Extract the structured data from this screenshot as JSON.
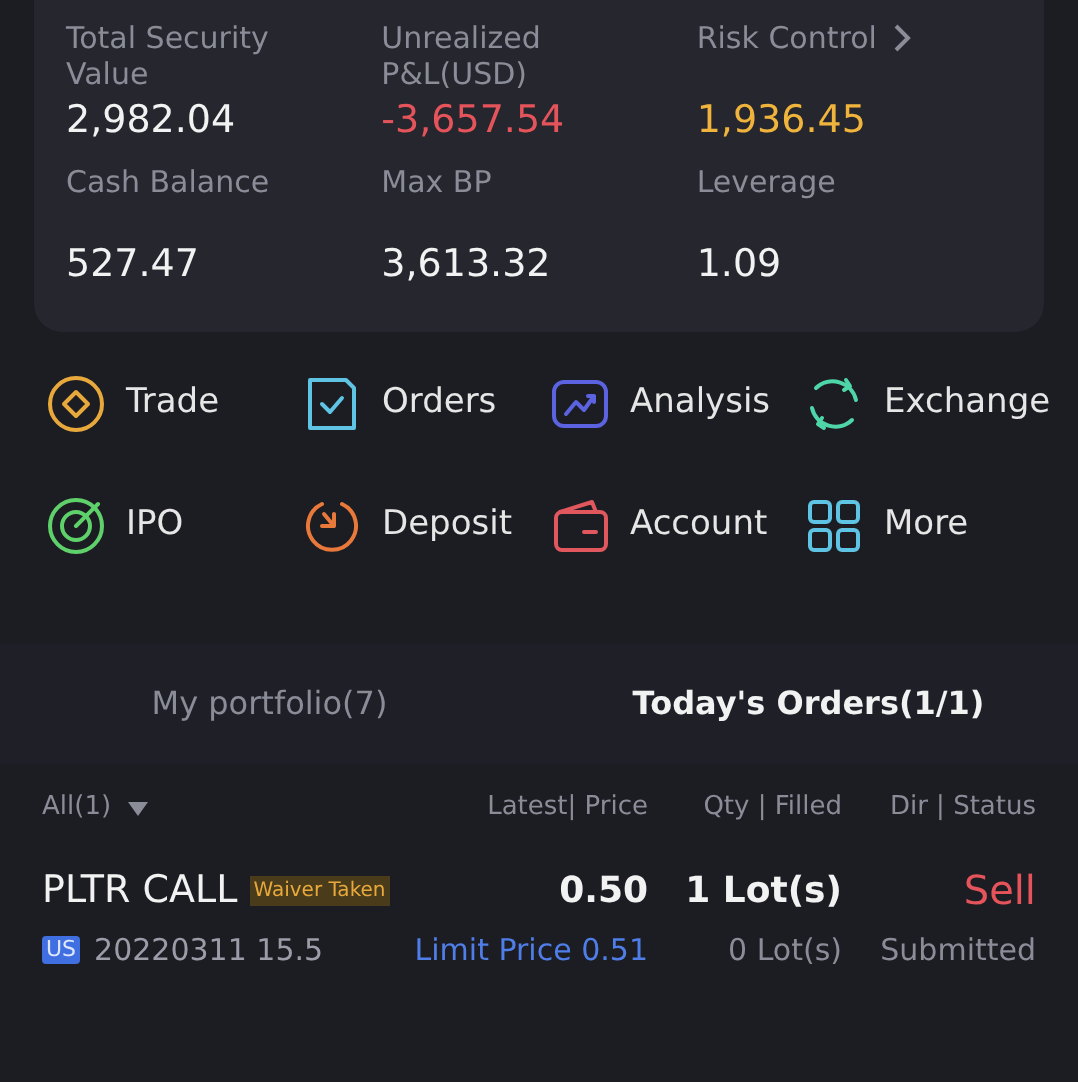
{
  "summary": {
    "metrics": [
      {
        "label": "Total Security Value",
        "value": "2,982.04",
        "color": "#f2f2f2",
        "link": false
      },
      {
        "label": "Unrealized P&L(USD)",
        "value": "-3,657.54",
        "color": "#e5545a",
        "link": false
      },
      {
        "label": "Risk Control",
        "value": "1,936.45",
        "color": "#f0b43c",
        "link": true
      },
      {
        "label": "Cash Balance",
        "value": "527.47",
        "color": "#f2f2f2",
        "link": false
      },
      {
        "label": "Max BP",
        "value": "3,613.32",
        "color": "#f2f2f2",
        "link": false
      },
      {
        "label": "Leverage",
        "value": "1.09",
        "color": "#f2f2f2",
        "link": false
      }
    ]
  },
  "actions": [
    {
      "label": "Trade",
      "kind": "trade",
      "color": "#e8a93c"
    },
    {
      "label": "Orders",
      "kind": "orders",
      "color": "#5fc3e4"
    },
    {
      "label": "Analysis",
      "kind": "analysis",
      "color": "#5b63e0"
    },
    {
      "label": "Exchange",
      "kind": "exchange",
      "color": "#4fd6a8"
    },
    {
      "label": "IPO",
      "kind": "ipo",
      "color": "#5fd16a"
    },
    {
      "label": "Deposit",
      "kind": "deposit",
      "color": "#e8793a"
    },
    {
      "label": "Account",
      "kind": "account",
      "color": "#e0585e"
    },
    {
      "label": "More",
      "kind": "more",
      "color": "#5fc3e4"
    }
  ],
  "tabs": [
    {
      "label": "My portfolio(7)",
      "selected": false
    },
    {
      "label": "Today's Orders(1/1)",
      "selected": true
    }
  ],
  "orders": {
    "filter": "All(1)",
    "columns": [
      "Latest| Price",
      "Qty | Filled",
      "Dir | Status"
    ],
    "rows": [
      {
        "name": "PLTR CALL",
        "badge": "Waiver Taken",
        "market": "US",
        "detail": "20220311 15.5",
        "latest": "0.50",
        "limit": "Limit Price 0.51",
        "qty": "1 Lot(s)",
        "filled": "0 Lot(s)",
        "direction": "Sell",
        "color": "#e5545a",
        "status": "Submitted"
      }
    ]
  }
}
